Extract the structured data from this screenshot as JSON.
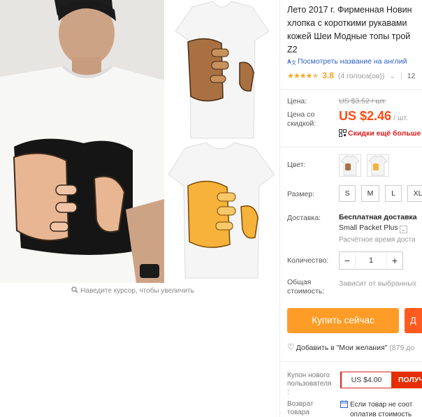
{
  "gallery": {
    "zoom_hint": "Наведите курсор, чтобы увеличить",
    "zoom_icon": "magnifier-icon"
  },
  "product": {
    "title": "Лето 2017 г. Фирменная Новин\nхлопка с короткими рукавами \nкожей Шеи Модные топы трой\nZ2",
    "translate_link": "Посмотреть название на англий",
    "translate_icon": "translate-icon",
    "stars": "★★★★",
    "rating": "3.8",
    "votes": "(4 голоса(ов))",
    "orders_partial": "12"
  },
  "price": {
    "label": "Цена:",
    "original": "US $3.52 / шт.",
    "discount_label": "Цена со скидкой:",
    "discounted": "US $2.46",
    "per_unit": "/ шт.",
    "promo": "Скидки ещё больше",
    "accent": "#ff4b14"
  },
  "color": {
    "label": "Цвет:"
  },
  "size": {
    "label": "Размер:",
    "options": [
      "S",
      "M",
      "L",
      "XL"
    ]
  },
  "shipping": {
    "label": "Доставка:",
    "free": "Бесплатная доставка",
    "method": "Small Packet Plus",
    "estimate": "Расчётное время доста"
  },
  "quantity": {
    "label": "Количество:",
    "value": "1",
    "minus": "−",
    "plus": "+"
  },
  "total": {
    "label": "Общая стоимость:",
    "note": "Зависит от выбранных"
  },
  "actions": {
    "buy_now": "Купить сейчас",
    "add_to_cart": "Д",
    "wishlist": "Добавить в \"Мои желания\"",
    "wishlist_count": "(879 до",
    "buy_color": "#ff9c27",
    "cart_color": "#ff5a1f"
  },
  "coupon": {
    "label": "Купон нового пользователя :",
    "value": "US $4.00",
    "get": "ПОЛУЧ"
  },
  "returns": {
    "label": "Возврат товара",
    "note_line1": "Если товар не соот",
    "note_line2": "оплатив стоимость"
  }
}
